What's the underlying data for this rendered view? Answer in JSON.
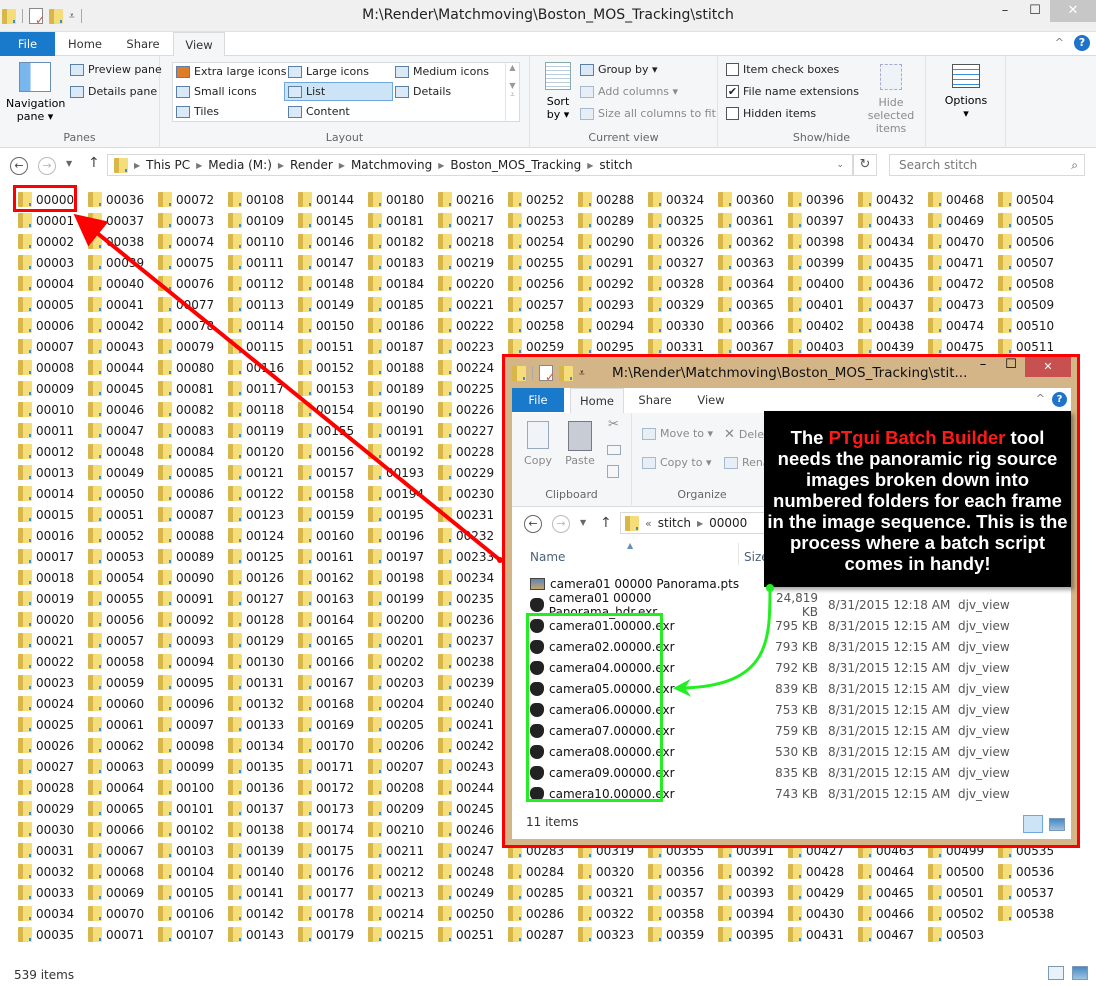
{
  "window": {
    "title": "M:\\Render\\Matchmoving\\Boston_MOS_Tracking\\stitch",
    "minimize": "–",
    "maximize": "☐",
    "close": "✕"
  },
  "tabs": [
    {
      "label": "File"
    },
    {
      "label": "Home"
    },
    {
      "label": "Share"
    },
    {
      "label": "View",
      "active": true
    }
  ],
  "ribbon": {
    "panes": {
      "label": "Panes",
      "navigation_pane": "Navigation pane",
      "navigation_pane_l1": "Navigation",
      "navigation_pane_l2": "pane ▾",
      "preview_pane": "Preview pane",
      "details_pane": "Details pane"
    },
    "layout": {
      "label": "Layout",
      "items": [
        "Extra large icons",
        "Large icons",
        "Medium icons",
        "Small icons",
        "List",
        "Details",
        "Tiles",
        "Content"
      ],
      "selected": "List"
    },
    "current_view": {
      "label": "Current view",
      "sort_l1": "Sort",
      "sort_l2": "by ▾",
      "group_by": "Group by ▾",
      "add_columns": "Add columns ▾",
      "size_columns": "Size all columns to fit"
    },
    "show_hide": {
      "label": "Show/hide",
      "item_check_boxes": "Item check boxes",
      "item_check_boxes_checked": false,
      "file_name_extensions": "File name extensions",
      "file_name_extensions_checked": true,
      "hidden_items": "Hidden items",
      "hidden_items_checked": false,
      "hide_selected_l1": "Hide selected",
      "hide_selected_l2": "items"
    },
    "options": {
      "label": "Options",
      "arrow": "▾"
    }
  },
  "address": {
    "crumbs": [
      "This PC",
      "Media (M:)",
      "Render",
      "Matchmoving",
      "Boston_MOS_Tracking",
      "stitch"
    ],
    "search_placeholder": "Search stitch"
  },
  "folders": {
    "first": 0,
    "last": 538,
    "rows_per_column": 36,
    "pad": 5
  },
  "status": {
    "items": "539 items"
  },
  "overlay_window": {
    "title": "M:\\Render\\Matchmoving\\Boston_MOS_Tracking\\stit...",
    "tabs": [
      "File",
      "Home",
      "Share",
      "View"
    ],
    "active_tab": "Home",
    "clipboard": {
      "label": "Clipboard",
      "copy": "Copy",
      "paste": "Paste"
    },
    "organize": {
      "label": "Organize",
      "move_to": "Move to ▾",
      "copy_to": "Copy to ▾",
      "delete": "Dele",
      "rename": "Rena"
    },
    "address": {
      "prefix": "«",
      "crumbs": [
        "stitch",
        "00000"
      ]
    },
    "columns": {
      "name": "Name",
      "size": "Size"
    },
    "files": [
      {
        "name": "camera01 00000 Panorama.pts",
        "size": "",
        "date": "",
        "type": "",
        "icon": "pts"
      },
      {
        "name": "camera01 00000 Panorama_hdr.exr",
        "size": "24,819 KB",
        "date": "8/31/2015 12:18 AM",
        "type": "djv_view",
        "icon": "exr"
      },
      {
        "name": "camera01.00000.exr",
        "size": "795 KB",
        "date": "8/31/2015 12:15 AM",
        "type": "djv_view",
        "icon": "exr"
      },
      {
        "name": "camera02.00000.exr",
        "size": "793 KB",
        "date": "8/31/2015 12:15 AM",
        "type": "djv_view",
        "icon": "exr"
      },
      {
        "name": "camera04.00000.exr",
        "size": "792 KB",
        "date": "8/31/2015 12:15 AM",
        "type": "djv_view",
        "icon": "exr"
      },
      {
        "name": "camera05.00000.exr",
        "size": "839 KB",
        "date": "8/31/2015 12:15 AM",
        "type": "djv_view",
        "icon": "exr"
      },
      {
        "name": "camera06.00000.exr",
        "size": "753 KB",
        "date": "8/31/2015 12:15 AM",
        "type": "djv_view",
        "icon": "exr"
      },
      {
        "name": "camera07.00000.exr",
        "size": "759 KB",
        "date": "8/31/2015 12:15 AM",
        "type": "djv_view",
        "icon": "exr"
      },
      {
        "name": "camera08.00000.exr",
        "size": "530 KB",
        "date": "8/31/2015 12:15 AM",
        "type": "djv_view",
        "icon": "exr"
      },
      {
        "name": "camera09.00000.exr",
        "size": "835 KB",
        "date": "8/31/2015 12:15 AM",
        "type": "djv_view",
        "icon": "exr"
      },
      {
        "name": "camera10.00000.exr",
        "size": "743 KB",
        "date": "8/31/2015 12:15 AM",
        "type": "djv_view",
        "icon": "exr"
      }
    ],
    "status": "11 items"
  },
  "annotation": {
    "pre": "The ",
    "highlight": "PTgui Batch Builder",
    "post": " tool needs the panoramic rig source images broken down into numbered folders for each frame in the image sequence. This is the process where a batch script comes in handy!",
    "highlight_color": "#ff1a1a",
    "box_color": "#ff0000",
    "green_color": "#22ee22"
  }
}
